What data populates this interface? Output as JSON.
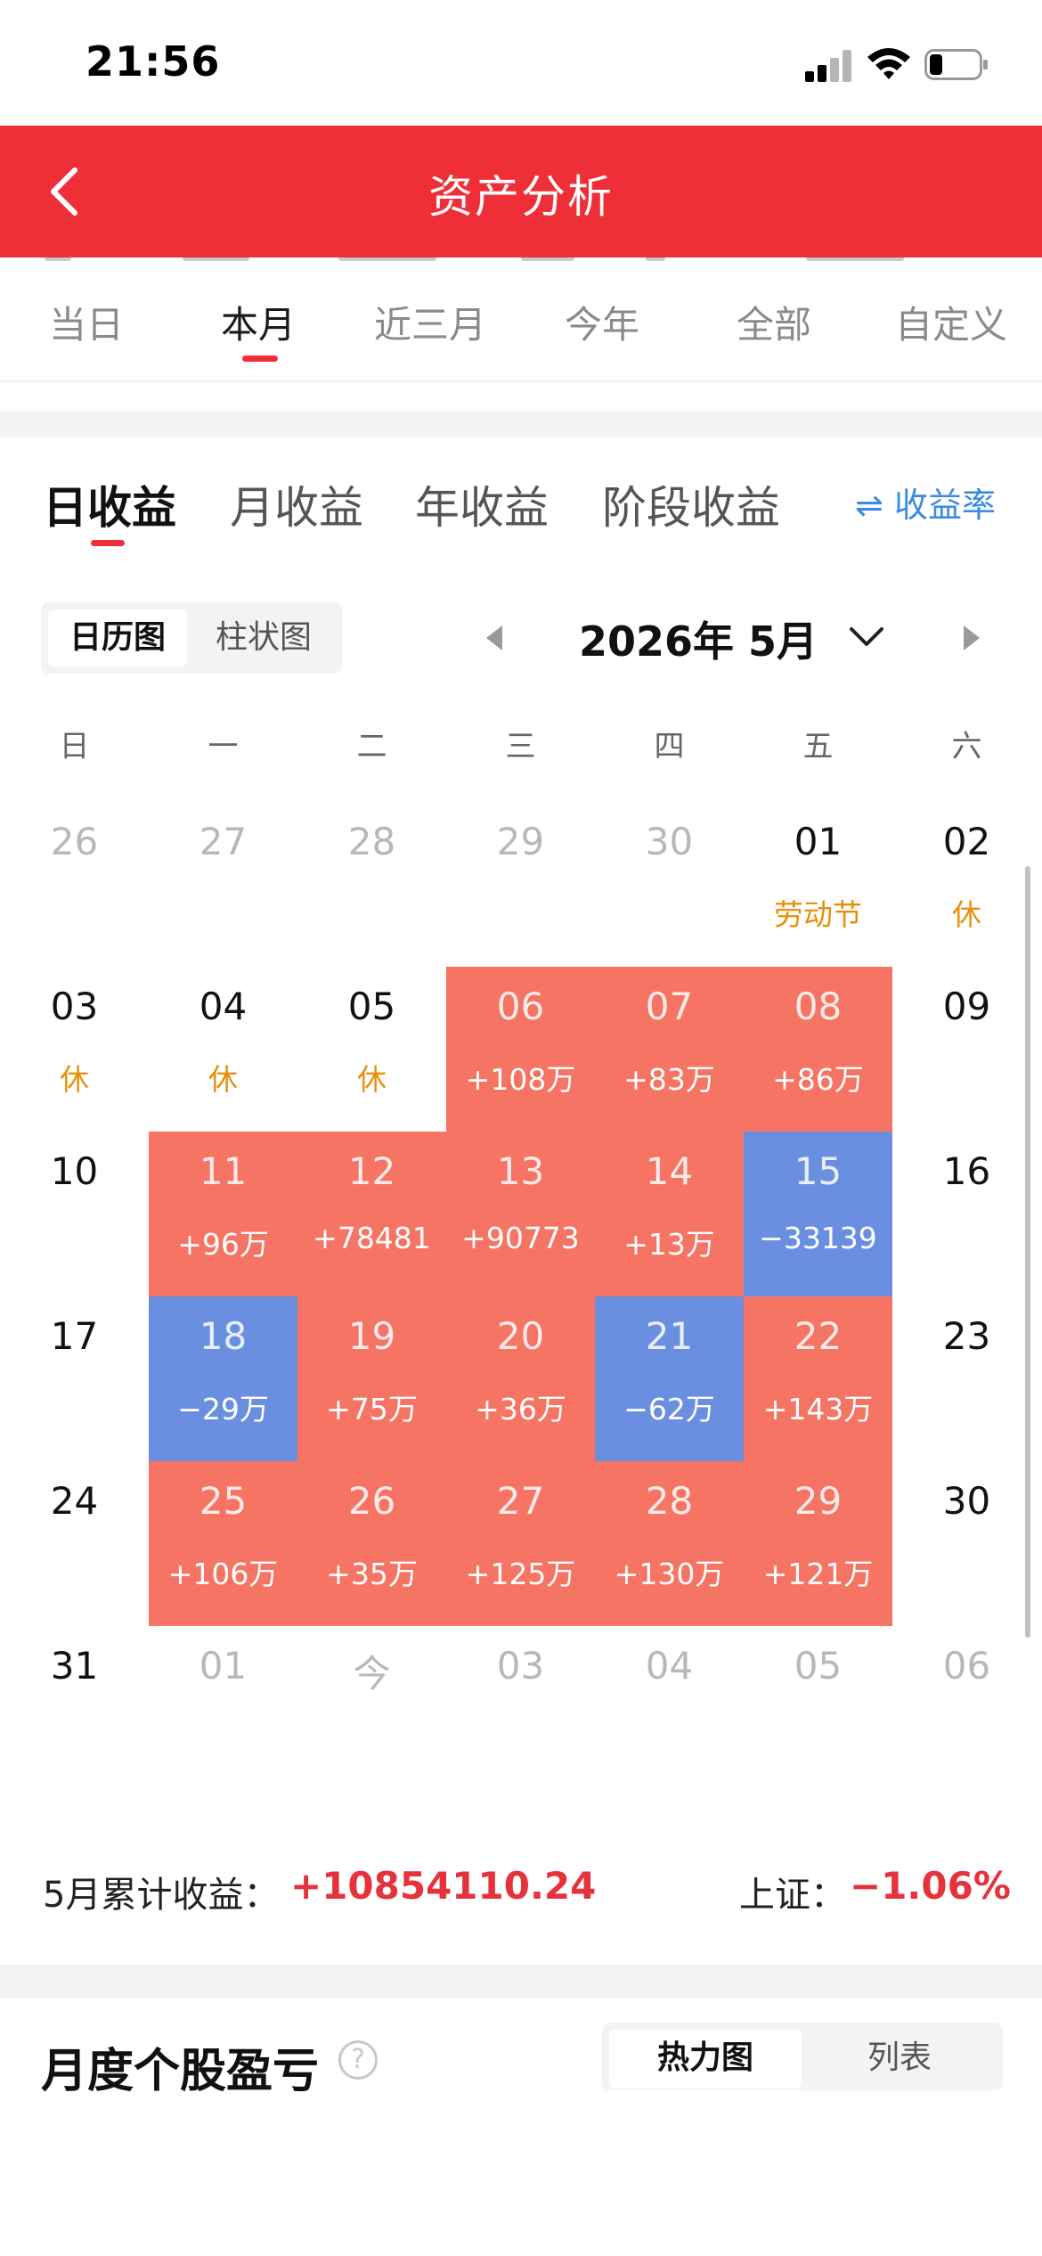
{
  "status_bar": {
    "time": "21:56"
  },
  "header": {
    "title": "资产分析"
  },
  "period_tabs": [
    "当日",
    "本月",
    "近三月",
    "今年",
    "全部",
    "自定义"
  ],
  "income_tabs": [
    "日收益",
    "月收益",
    "年收益",
    "阶段收益"
  ],
  "rate_toggle": {
    "icon": "swap-icon",
    "symbol": "⇌",
    "label": "收益率"
  },
  "chart_view": {
    "options": [
      "日历图",
      "柱状图"
    ],
    "selected": "日历图"
  },
  "month_selector": {
    "label": "2026年 5月"
  },
  "weekdays": [
    "日",
    "一",
    "二",
    "三",
    "四",
    "五",
    "六"
  ],
  "calendar": [
    [
      {
        "day": "26",
        "sub": "",
        "state": "dim"
      },
      {
        "day": "27",
        "sub": "",
        "state": "dim"
      },
      {
        "day": "28",
        "sub": "",
        "state": "dim"
      },
      {
        "day": "29",
        "sub": "",
        "state": "dim"
      },
      {
        "day": "30",
        "sub": "",
        "state": "dim"
      },
      {
        "day": "01",
        "sub": "劳动节",
        "state": "holiday"
      },
      {
        "day": "02",
        "sub": "休",
        "state": "holiday"
      }
    ],
    [
      {
        "day": "03",
        "sub": "休",
        "state": "holiday"
      },
      {
        "day": "04",
        "sub": "休",
        "state": "holiday"
      },
      {
        "day": "05",
        "sub": "休",
        "state": "holiday"
      },
      {
        "day": "06",
        "sub": "+108万",
        "state": "up"
      },
      {
        "day": "07",
        "sub": "+83万",
        "state": "up"
      },
      {
        "day": "08",
        "sub": "+86万",
        "state": "up"
      },
      {
        "day": "09",
        "sub": "",
        "state": "normal"
      }
    ],
    [
      {
        "day": "10",
        "sub": "",
        "state": "normal"
      },
      {
        "day": "11",
        "sub": "+96万",
        "state": "up"
      },
      {
        "day": "12",
        "sub": "+78481",
        "state": "up"
      },
      {
        "day": "13",
        "sub": "+90773",
        "state": "up"
      },
      {
        "day": "14",
        "sub": "+13万",
        "state": "up"
      },
      {
        "day": "15",
        "sub": "−33139",
        "state": "down"
      },
      {
        "day": "16",
        "sub": "",
        "state": "normal"
      }
    ],
    [
      {
        "day": "17",
        "sub": "",
        "state": "normal"
      },
      {
        "day": "18",
        "sub": "−29万",
        "state": "down"
      },
      {
        "day": "19",
        "sub": "+75万",
        "state": "up"
      },
      {
        "day": "20",
        "sub": "+36万",
        "state": "up"
      },
      {
        "day": "21",
        "sub": "−62万",
        "state": "down"
      },
      {
        "day": "22",
        "sub": "+143万",
        "state": "up"
      },
      {
        "day": "23",
        "sub": "",
        "state": "normal"
      }
    ],
    [
      {
        "day": "24",
        "sub": "",
        "state": "normal"
      },
      {
        "day": "25",
        "sub": "+106万",
        "state": "up"
      },
      {
        "day": "26",
        "sub": "+35万",
        "state": "up"
      },
      {
        "day": "27",
        "sub": "+125万",
        "state": "up"
      },
      {
        "day": "28",
        "sub": "+130万",
        "state": "up"
      },
      {
        "day": "29",
        "sub": "+121万",
        "state": "up"
      },
      {
        "day": "30",
        "sub": "",
        "state": "normal"
      }
    ],
    [
      {
        "day": "31",
        "sub": "",
        "state": "normal"
      },
      {
        "day": "01",
        "sub": "",
        "state": "dim"
      },
      {
        "day": "今",
        "sub": "",
        "state": "dim"
      },
      {
        "day": "03",
        "sub": "",
        "state": "dim"
      },
      {
        "day": "04",
        "sub": "",
        "state": "dim"
      },
      {
        "day": "05",
        "sub": "",
        "state": "dim"
      },
      {
        "day": "06",
        "sub": "",
        "state": "dim"
      }
    ]
  ],
  "summary": {
    "label": "5月累计收益：",
    "value": "+10854110.24",
    "index_label": "上证：",
    "index_value": "−1.06%"
  },
  "stock_pnl": {
    "title": "月度个股盈亏",
    "help_symbol": "?",
    "view_options": [
      "热力图",
      "列表"
    ],
    "selected": "热力图"
  },
  "colors": {
    "header": "#ee2f38",
    "gain_cell": "#f57463",
    "loss_cell": "#6b8fe0",
    "holiday": "#e8900c",
    "accent_blue": "#3c8be0",
    "positive_text": "#e5323b"
  }
}
